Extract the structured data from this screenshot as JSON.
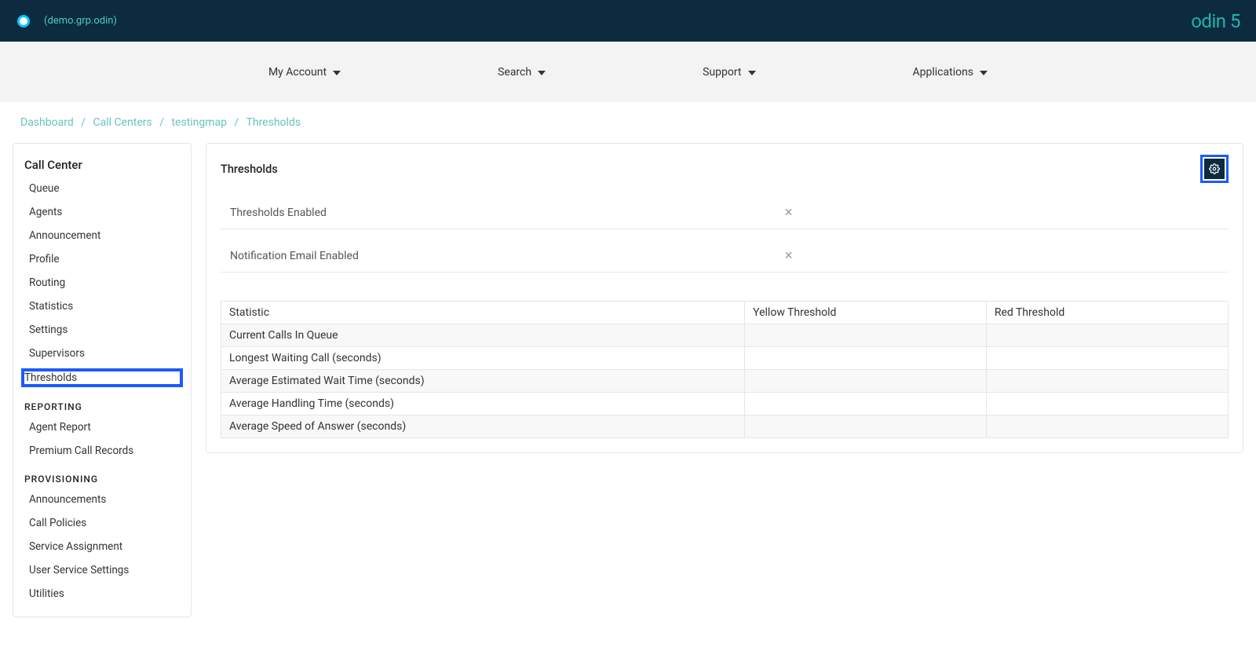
{
  "topbar": {
    "env": "(demo.grp.odin)",
    "brand": "odin 5"
  },
  "menu": {
    "account": "My Account",
    "search": "Search",
    "support": "Support",
    "applications": "Applications"
  },
  "breadcrumb": {
    "dashboard": "Dashboard",
    "callcenters": "Call Centers",
    "testingmap": "testingmap",
    "thresholds": "Thresholds"
  },
  "sidebar": {
    "title": "Call Center",
    "items1": {
      "queue": "Queue",
      "agents": "Agents",
      "announcement": "Announcement",
      "profile": "Profile",
      "routing": "Routing",
      "statistics": "Statistics",
      "settings": "Settings",
      "supervisors": "Supervisors",
      "thresholds": "Thresholds"
    },
    "section_reporting": "REPORTING",
    "items2": {
      "agent_report": "Agent Report",
      "premium_call_records": "Premium Call Records"
    },
    "section_provisioning": "PROVISIONING",
    "items3": {
      "announcements": "Announcements",
      "call_policies": "Call Policies",
      "service_assignment": "Service Assignment",
      "user_service_settings": "User Service Settings",
      "utilities": "Utilities"
    }
  },
  "panel": {
    "title": "Thresholds",
    "thresholds_enabled_label": "Thresholds Enabled",
    "notification_email_label": "Notification Email Enabled",
    "x_glyph": "✕"
  },
  "table": {
    "col_statistic": "Statistic",
    "col_yellow": "Yellow Threshold",
    "col_red": "Red Threshold",
    "rows": {
      "0": "Current Calls In Queue",
      "1": "Longest Waiting Call (seconds)",
      "2": "Average Estimated Wait Time (seconds)",
      "3": "Average Handling Time (seconds)",
      "4": "Average Speed of Answer (seconds)"
    }
  }
}
